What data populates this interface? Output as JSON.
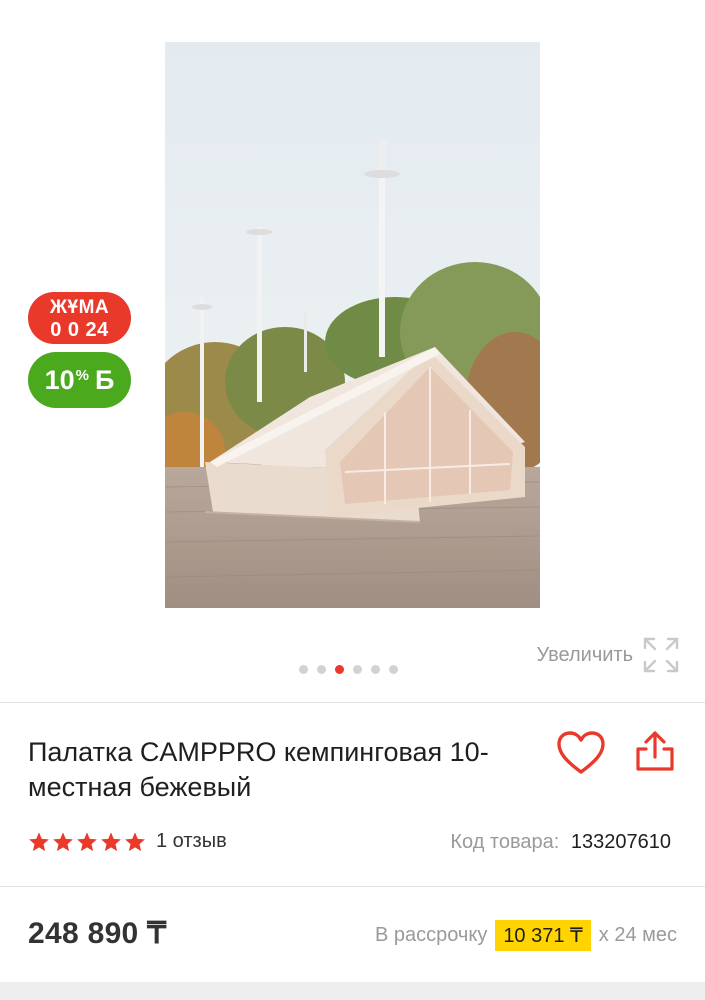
{
  "badges": {
    "friday_label": "ЖҰМА",
    "friday_timer": "0 0 24",
    "bonus_percent": "10",
    "bonus_symbol": "%",
    "bonus_currency": "Б",
    "friday_color": "#e8392b",
    "bonus_color": "#4ba91e"
  },
  "gallery": {
    "slide_count": 6,
    "active_slide": 3,
    "zoom_label": "Увеличить",
    "zoom_icon": "expand-icon"
  },
  "product": {
    "title": "Палатка CAMPPRO кемпинговая 10-местная бежевый",
    "rating": 5,
    "reviews": "1 отзыв",
    "sku_label": "Код товара:",
    "sku_value": "133207610",
    "favorite_icon": "heart-icon",
    "share_icon": "share-icon"
  },
  "pricing": {
    "price": "248 890 ₸",
    "installment_label": "В рассрочку",
    "installment_amount": "10 371 ₸",
    "installment_term": "х 24 мес",
    "highlight_color": "#ffd400"
  },
  "colors": {
    "accent": "#e8392b",
    "muted_text": "#9a9a9a"
  }
}
